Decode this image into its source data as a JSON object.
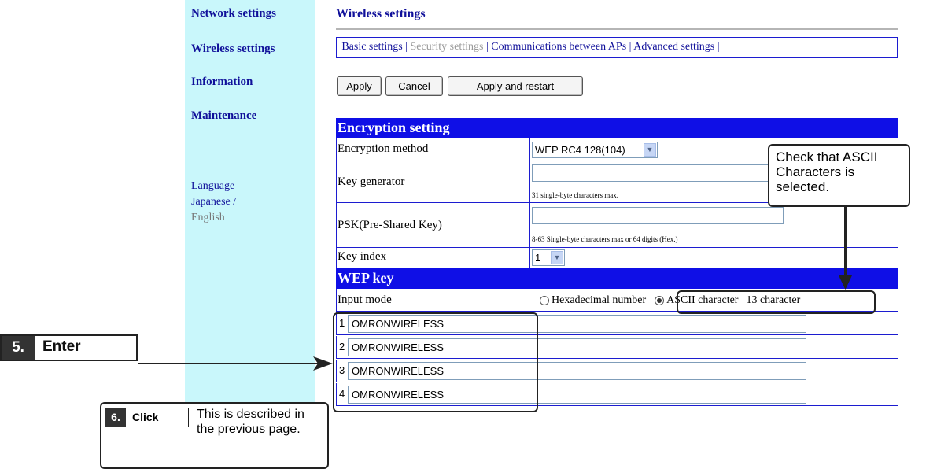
{
  "sidebar": {
    "nav": [
      "Network settings",
      "Wireless settings",
      "Information",
      "Maintenance"
    ],
    "language_label": "Language",
    "language_japanese": "Japanese",
    "language_sep": " /",
    "language_english": "English"
  },
  "header": {
    "title": "Wireless settings"
  },
  "subnav": {
    "items": [
      "Basic settings",
      "Security settings",
      "Communications between APs",
      "Advanced settings"
    ],
    "active": "Security settings"
  },
  "toolbar": {
    "apply_label": "Apply",
    "cancel_label": "Cancel",
    "apply_restart_label": "Apply and restart"
  },
  "encryption": {
    "header": "Encryption setting",
    "method_label": "Encryption method",
    "method_value": "WEP RC4 128(104)",
    "keygen_label": "Key generator",
    "keygen_value": "",
    "keygen_hint": "31 single-byte characters max.",
    "psk_label": "PSK(Pre-Shared Key)",
    "psk_value": "",
    "psk_hint": "8-63 Single-byte characters max or 64 digits (Hex.)",
    "key_index_label": "Key index",
    "key_index_value": "1"
  },
  "wep": {
    "header": "WEP key",
    "input_mode_label": "Input mode",
    "mode_hex_label": "Hexadecimal number",
    "mode_ascii_label": "ASCII character",
    "mode_ascii_count": "13 character",
    "selected_mode": "ascii",
    "keys": [
      {
        "num": "1",
        "value": "OMRONWIRELESS"
      },
      {
        "num": "2",
        "value": "OMRONWIRELESS"
      },
      {
        "num": "3",
        "value": "OMRONWIRELESS"
      },
      {
        "num": "4",
        "value": "OMRONWIRELESS"
      }
    ]
  },
  "annotations": {
    "ascii_note": "Check that ASCII Characters is selected.",
    "step5_num": "5.",
    "step5_word": "Enter",
    "step6_num": "6.",
    "step6_word": "Click",
    "step6_text": "This is described in the previous page."
  }
}
